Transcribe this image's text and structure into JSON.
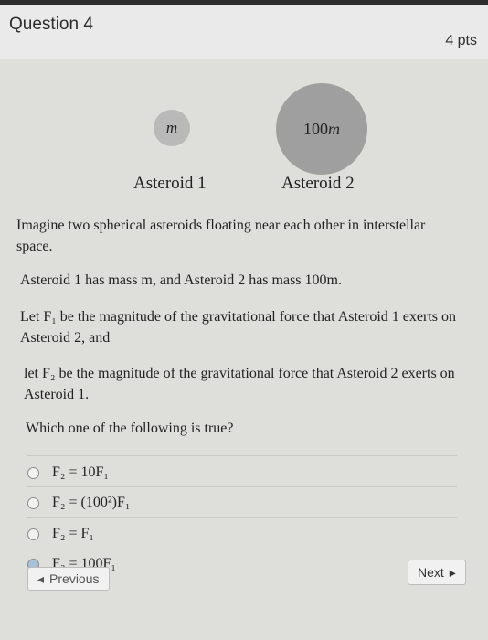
{
  "header": {
    "title": "Question 4",
    "points": "4 pts"
  },
  "figure": {
    "asteroid1_mass": "m",
    "asteroid2_mass_number": "100",
    "asteroid2_mass_var": "m",
    "asteroid1_label": "Asteroid 1",
    "asteroid2_label": "Asteroid 2"
  },
  "question": {
    "intro": "Imagine two spherical asteroids floating near each other in interstellar space.",
    "masses": "Asteroid 1 has mass m, and Asteroid 2 has mass 100m.",
    "f1_def": "Let F₁ be the magnitude of the gravitational force that Asteroid 1 exerts on Asteroid 2, and",
    "f2_def": "let F₂ be the magnitude of the gravitational force that Asteroid 2 exerts on Asteroid 1.",
    "prompt": "Which one of the following is true?"
  },
  "options": [
    {
      "text": "F₂ = 10F₁"
    },
    {
      "text": "F₂ = (100²)F₁"
    },
    {
      "text": "F₂ = F₁"
    },
    {
      "text": "F₂ = 100F₁"
    }
  ],
  "nav": {
    "previous": "Previous",
    "next": "Next"
  }
}
